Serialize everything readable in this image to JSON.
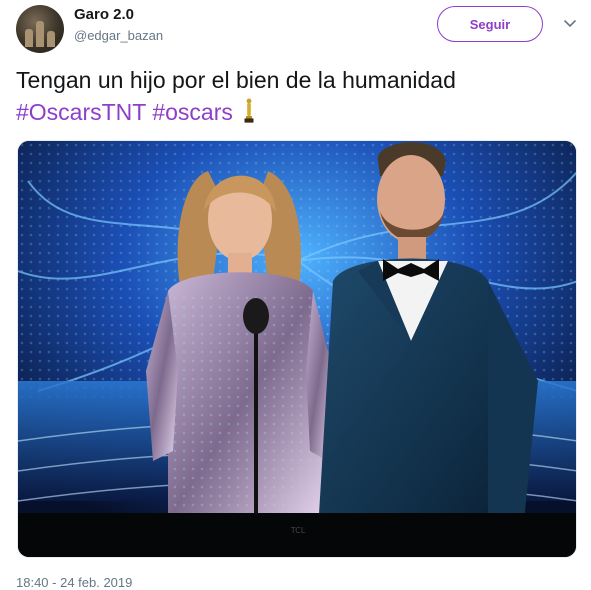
{
  "user": {
    "display_name": "Garo 2.0",
    "handle": "@edgar_bazan",
    "avatar_icon": "avatar-photo"
  },
  "follow_button": {
    "label": "Seguir"
  },
  "menu": {
    "icon": "chevron-down-icon"
  },
  "tweet": {
    "text": "Tengan un hijo por el bien de la humanidad",
    "hashtags": [
      "#OscarsTNT",
      "#oscars"
    ],
    "emoji": "oscar-statuette-icon"
  },
  "media": {
    "kind": "photo"
  },
  "timestamp": "18:40 - 24 feb. 2019",
  "colors": {
    "accent": "#8e3ec9",
    "text": "#14171a",
    "secondary_text": "#657786",
    "border": "#e6ecf0"
  }
}
